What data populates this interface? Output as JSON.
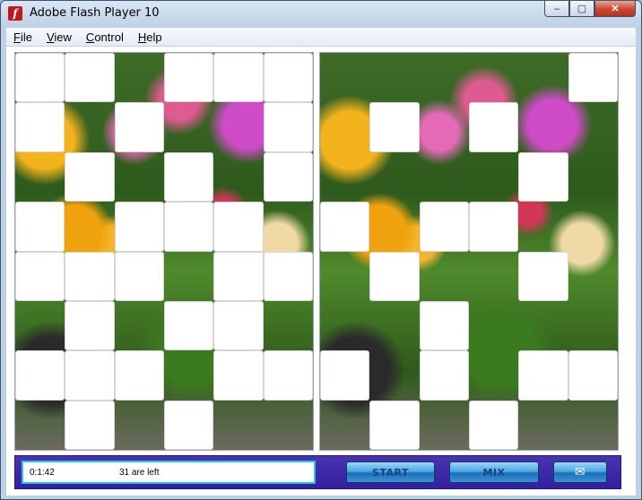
{
  "window": {
    "title": "Adobe Flash Player 10",
    "app_icon": "flash-icon",
    "controls": {
      "minimize": "–",
      "maximize": "▢",
      "close": "✕"
    }
  },
  "menu": [
    {
      "label": "File",
      "accel": "F",
      "rest": "ile"
    },
    {
      "label": "View",
      "accel": "V",
      "rest": "iew"
    },
    {
      "label": "Control",
      "accel": "C",
      "rest": "ontrol"
    },
    {
      "label": "Help",
      "accel": "H",
      "rest": "elp"
    }
  ],
  "game": {
    "timer": "0:1:42",
    "remaining": "31 are left",
    "buttons": {
      "start": "START",
      "mix": "MIX",
      "mail": "✉"
    },
    "mail_icon": "envelope-icon"
  }
}
